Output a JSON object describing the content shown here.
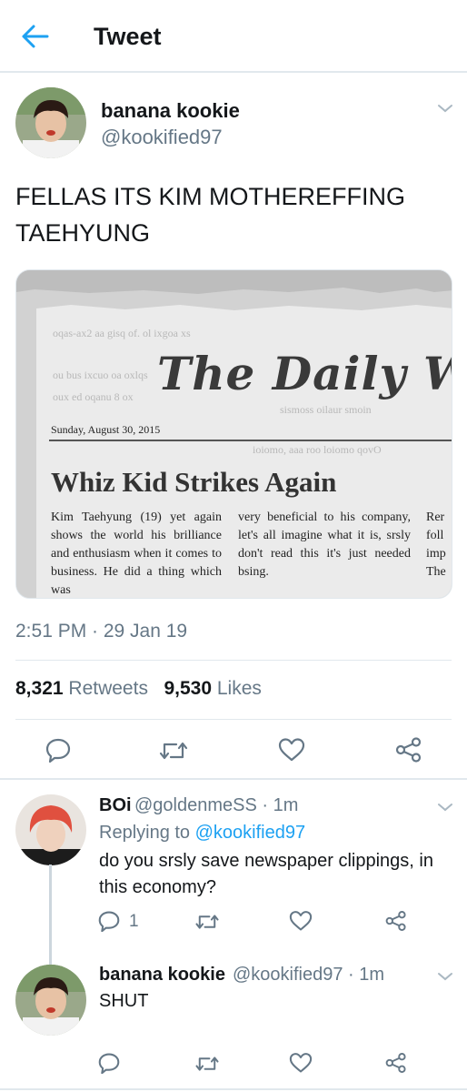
{
  "header": {
    "title": "Tweet",
    "back_icon": "arrow-left-icon",
    "accent": "#1da1f2"
  },
  "main_tweet": {
    "name": "banana kookie",
    "handle": "@kookified97",
    "text": "FELLAS ITS KIM MOTHEREFFING TAEHYUNG",
    "timestamp": "2:51 PM · 29 Jan 19",
    "retweets_count": "8,321",
    "retweets_label": "Retweets",
    "likes_count": "9,530",
    "likes_label": "Likes",
    "media": {
      "masthead": "The Daily W",
      "date": "Sunday, August 30, 2015",
      "headline": "Whiz Kid Strikes Again",
      "col1": "Kim Taehyung (19) yet again shows the world his brilliance and enthusiasm when it comes to business. He did a thing which was",
      "col2": "very beneficial to his company, let's all imagine what it is, srsly don't read this it's just needed bsing.",
      "col3": "Rer foll imp The"
    }
  },
  "replies": [
    {
      "name": "BOi",
      "handle": "@goldenmeSS",
      "time": "· 1m",
      "replying_prefix": "Replying to",
      "replying_handle": "@kookified97",
      "text": "do you srsly save newspaper clippings, in this economy?",
      "reply_count": "1"
    },
    {
      "name": "banana kookie",
      "handle": "@kookified97",
      "time": "· 1m",
      "text": "SHUT"
    }
  ]
}
